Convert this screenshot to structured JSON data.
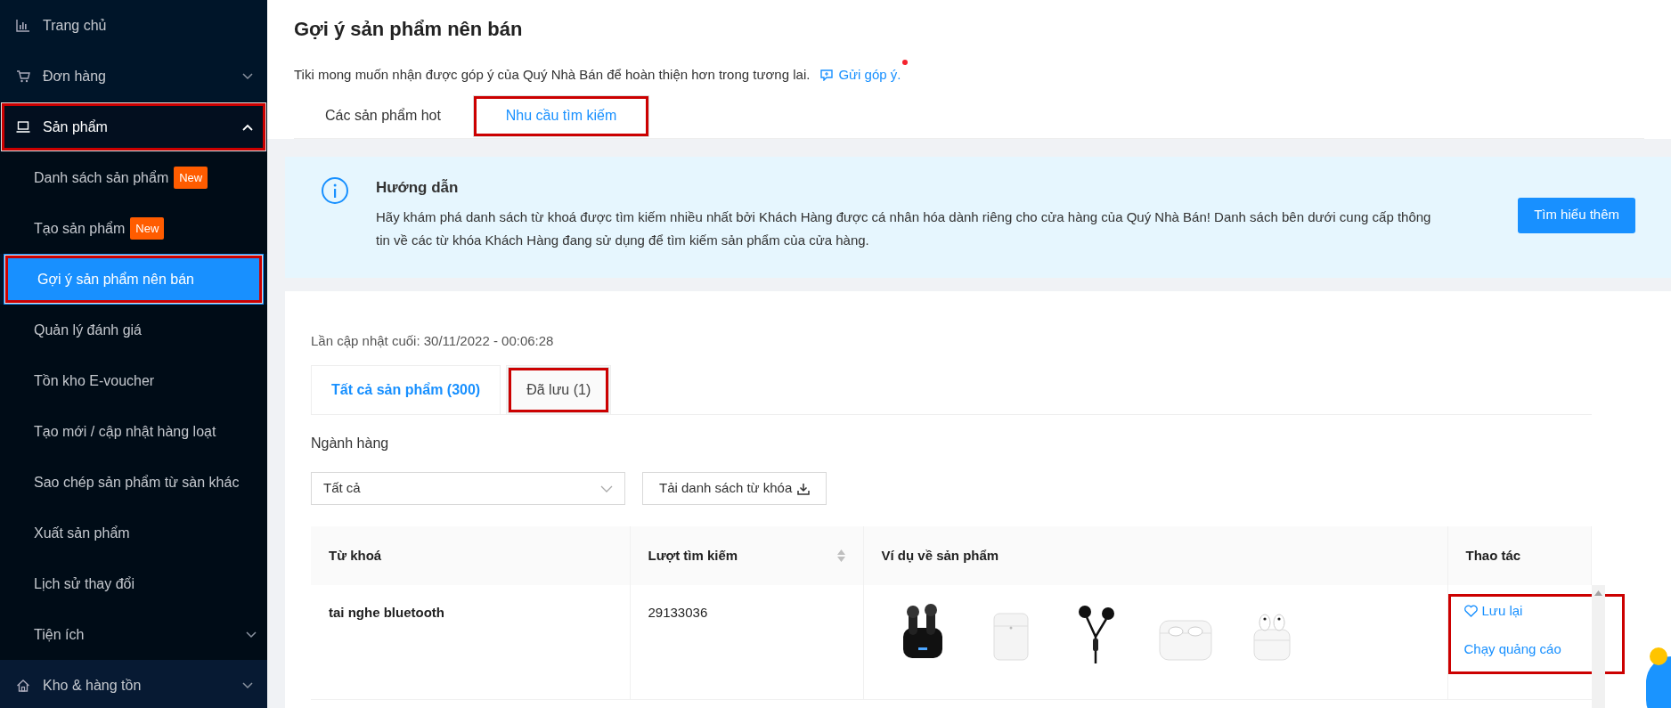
{
  "sidebar": {
    "items": [
      {
        "label": "Trang chủ",
        "highlighted": false
      },
      {
        "label": "Đơn hàng",
        "expanded": false,
        "highlighted": false
      },
      {
        "label": "Sản phẩm",
        "expanded": true,
        "highlighted": true,
        "children": [
          {
            "label": "Danh sách sản phẩm",
            "badge": "New",
            "selected": false,
            "highlighted": false
          },
          {
            "label": "Tạo sản phẩm",
            "badge": "New",
            "selected": false,
            "highlighted": false
          },
          {
            "label": "Gợi ý sản phẩm nên bán",
            "selected": true,
            "highlighted": true
          },
          {
            "label": "Quản lý đánh giá",
            "selected": false,
            "highlighted": false
          },
          {
            "label": "Tồn kho E-voucher",
            "selected": false,
            "highlighted": false
          },
          {
            "label": "Tạo mới / cập nhật hàng loạt",
            "selected": false,
            "highlighted": false
          },
          {
            "label": "Sao chép sản phẩm từ sàn khác",
            "selected": false,
            "highlighted": false
          },
          {
            "label": "Xuất sản phẩm",
            "selected": false,
            "highlighted": false
          },
          {
            "label": "Lịch sử thay đổi",
            "selected": false,
            "highlighted": false
          },
          {
            "label": "Tiện ích",
            "expanded": false,
            "selected": false,
            "highlighted": false
          }
        ]
      },
      {
        "label": "Kho & hàng tồn",
        "expanded": false,
        "highlighted": false
      }
    ]
  },
  "page": {
    "title": "Gợi ý sản phẩm nên bán",
    "feedback_text": "Tiki mong muốn nhận được góp ý của Quý Nhà Bán để hoàn thiện hơn trong tương lai.",
    "feedback_link": "Gửi góp ý.",
    "tabs": [
      {
        "label": "Các sản phẩm hot",
        "selected": false,
        "highlighted": false
      },
      {
        "label": "Nhu cầu tìm kiếm",
        "selected": true,
        "highlighted": true
      }
    ]
  },
  "guide": {
    "title": "Hướng dẫn",
    "text": "Hãy khám phá danh sách từ khoá được tìm kiếm nhiều nhất bởi Khách Hàng được cá nhân hóa dành riêng cho cửa hàng của Quý Nhà Bán! Danh sách bên dưới cung cấp thông tin về các từ khóa Khách Hàng đang sử dụng để tìm kiếm sản phẩm của cửa hàng.",
    "button": "Tìm hiểu thêm"
  },
  "content": {
    "last_updated": "Lần cập nhật cuối: 30/11/2022 - 00:06:28",
    "tabs": [
      {
        "label": "Tất cả sản phẩm (300)",
        "selected": true,
        "highlighted": false
      },
      {
        "label": "Đã lưu (1)",
        "selected": false,
        "highlighted": true
      }
    ],
    "filter_label": "Ngành hàng",
    "category_select": {
      "value": "Tất cả"
    },
    "download_button": "Tải danh sách từ khóa"
  },
  "table": {
    "columns": [
      {
        "label": "Từ khoá"
      },
      {
        "label": "Lượt tìm kiếm",
        "sortable": true
      },
      {
        "label": "Ví dụ về sản phẩm"
      },
      {
        "label": "Thao tác"
      }
    ],
    "rows": [
      {
        "keyword": "tai nghe bluetooth",
        "searches": "29133036",
        "actions": {
          "highlighted": true,
          "items": [
            {
              "kind": "save",
              "label": "Lưu lại"
            },
            {
              "kind": "ads",
              "label": "Chạy quảng cáo"
            }
          ]
        }
      }
    ]
  }
}
